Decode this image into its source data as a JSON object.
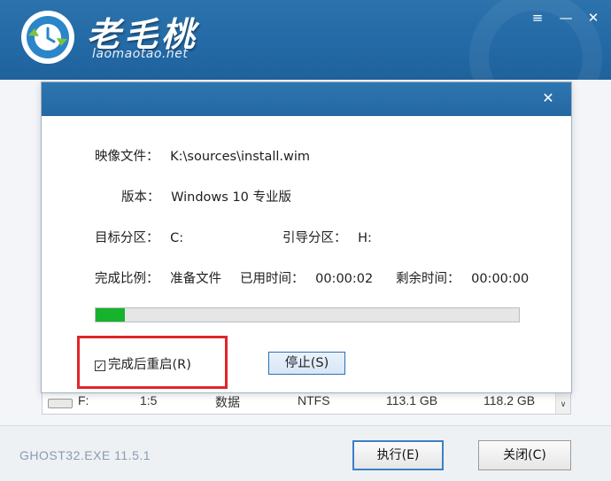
{
  "header": {
    "brand_title": "老毛桃",
    "brand_url": "laomaotao.net",
    "menu_label": "≡",
    "minimize_label": "—",
    "close_label": "✕",
    "accent": "#2468a3"
  },
  "dialog": {
    "close_label": "✕",
    "image_file_label": "映像文件：",
    "image_file_value": "K:\\sources\\install.wim",
    "version_label": "版本：",
    "version_value": "Windows 10 专业版",
    "target_label": "目标分区：",
    "target_value": "C:",
    "boot_label": "引导分区：",
    "boot_value": "H:",
    "ratio_label": "完成比例：",
    "ratio_value": "准备文件",
    "elapsed_label": "已用时间：",
    "elapsed_value": "00:00:02",
    "remaining_label": "剩余时间：",
    "remaining_value": "00:00:00",
    "progress_fraction": 0.07,
    "progress_color": "#15b42c",
    "checkbox_mark": "☑",
    "reboot_label": "完成后重启(R)",
    "reboot_checked": true,
    "stop_button": "停止(S)"
  },
  "list": {
    "drive": "F:",
    "ratio": "1:5",
    "type": "数据",
    "fs": "NTFS",
    "size1": "113.1 GB",
    "size2": "118.2 GB",
    "scroll_down": "∨"
  },
  "footer": {
    "version": "GHOST32.EXE 11.5.1",
    "execute_button": "执行(E)",
    "close_button": "关闭(C)"
  }
}
